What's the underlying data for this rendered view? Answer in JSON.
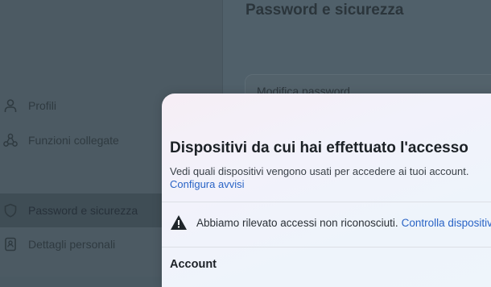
{
  "background": {
    "page_title": "Password e sicurezza",
    "card_label": "Modifica password",
    "nav": [
      {
        "label": "Profili",
        "icon": "person-icon"
      },
      {
        "label": "Funzioni collegate",
        "icon": "connected-features-icon"
      },
      {
        "label": "Password e sicurezza",
        "icon": "shield-icon",
        "active": true
      },
      {
        "label": "Dettagli personali",
        "icon": "id-card-icon"
      }
    ]
  },
  "modal": {
    "title": "Dispositivi da cui hai effettuato l'accesso",
    "description": "Vedi quali dispositivi vengono usati per accedere ai tuoi account.",
    "link": "Configura avvisi",
    "alert_text": "Abbiamo rilevato accessi non riconosciuti.",
    "alert_link": "Controlla dispositivi",
    "alert_icon": "warning-icon",
    "section_heading": "Account"
  },
  "colors": {
    "link": "#2a64c6",
    "overlay": "#4f5d66"
  }
}
